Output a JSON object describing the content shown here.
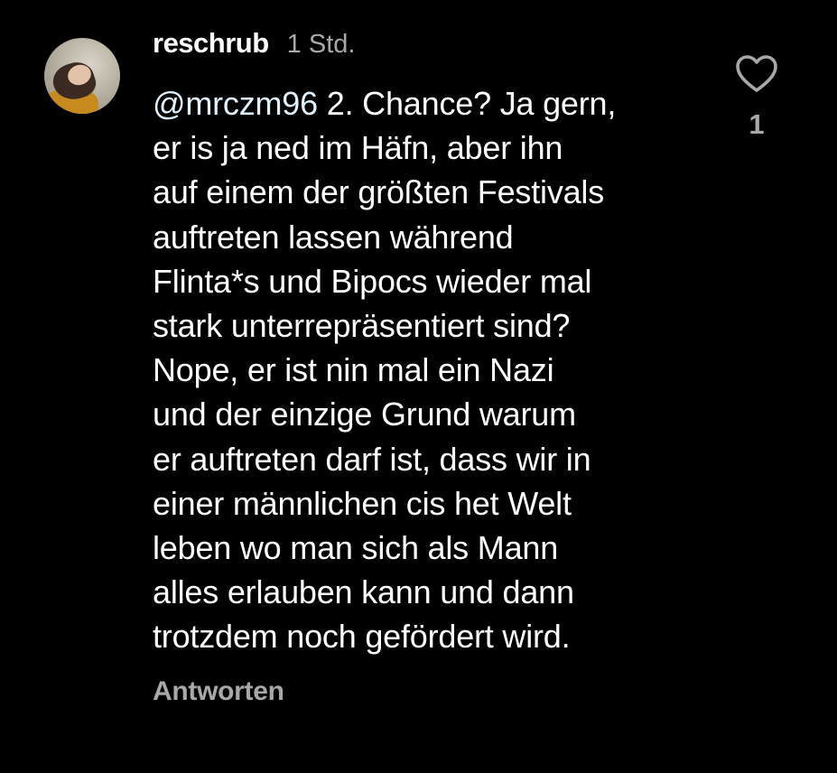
{
  "comment": {
    "username": "reschrub",
    "time": "1 Std.",
    "mention": "@mrczm96",
    "lines": [
      " 2. Chance? Ja gern,",
      "er is ja ned im Häfn, aber ihn",
      "auf einem der größten Festivals",
      "auftreten lassen während",
      "Flinta*s und Bipocs wieder mal",
      "stark unterrepräsentiert sind?",
      "Nope, er ist nin mal ein Nazi",
      "und der einzige Grund warum",
      "er auftreten darf ist, dass wir in",
      "einer männlichen cis het Welt",
      "leben wo man sich als Mann",
      "alles erlauben kann und dann",
      "trotzdem noch gefördert wird."
    ],
    "reply_label": "Antworten",
    "like_icon": "heart-outline-icon",
    "like_count": "1"
  },
  "colors": {
    "background": "#000000",
    "text": "#ffffff",
    "secondary": "#a8a8a8",
    "mention": "#e0f1ff"
  }
}
